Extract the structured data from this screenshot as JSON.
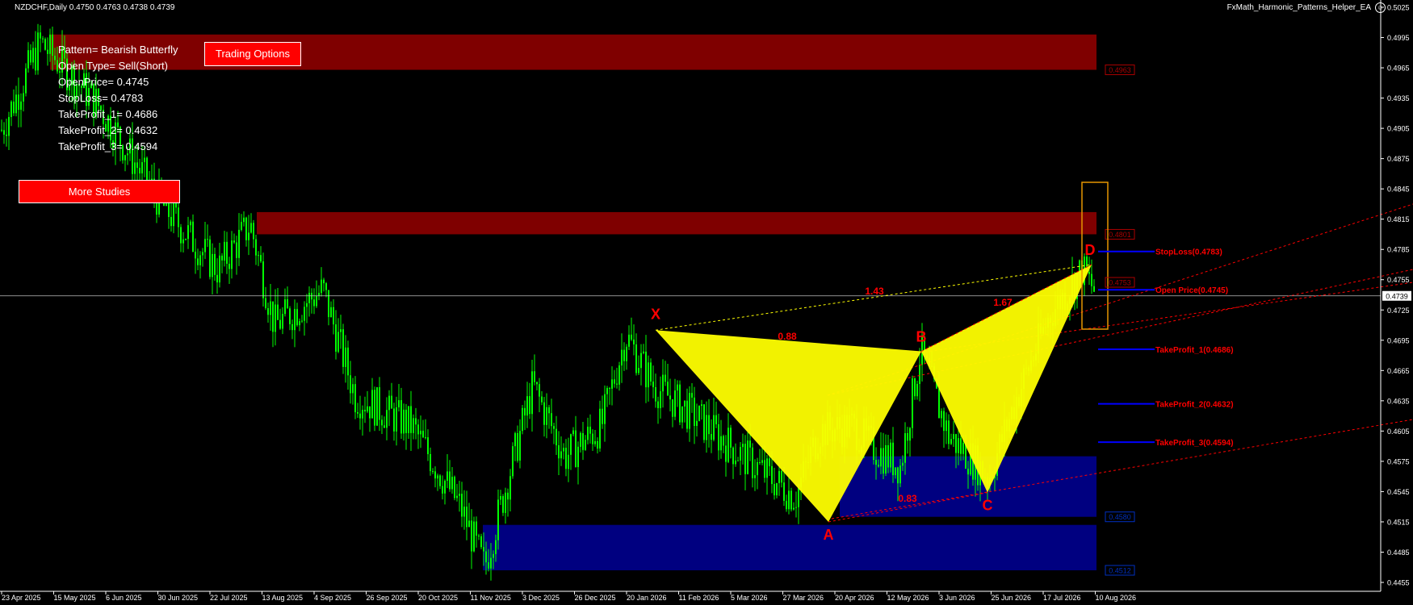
{
  "window": {
    "symbol_line": "NZDCHF,Daily  0.4750 0.4763 0.4738 0.4739",
    "ea_name": "FxMath_Harmonic_Patterns_Helper_EA",
    "ea_icon": "smiley-icon"
  },
  "info": {
    "pattern": "Pattern= Bearish Butterfly",
    "open_type": "Open Type= Sell(Short)",
    "open_price": "OpenPrice= 0.4745",
    "stop_loss": "StopLoss= 0.4783",
    "tp1": "TakeProfit_1= 0.4686",
    "tp2": "TakeProfit_2= 0.4632",
    "tp3": "TakeProfit_3= 0.4594"
  },
  "buttons": {
    "trading_options": "Trading Options",
    "more_studies": "More Studies"
  },
  "price_axis": {
    "labels": [
      "0.5025",
      "0.4995",
      "0.4965",
      "0.4935",
      "0.4905",
      "0.4875",
      "0.4845",
      "0.4815",
      "0.4785",
      "0.4755",
      "0.4725",
      "0.4695",
      "0.4665",
      "0.4635",
      "0.4605",
      "0.4575",
      "0.4545",
      "0.4515",
      "0.4485",
      "0.4455"
    ],
    "current_price": "0.4739"
  },
  "time_axis": {
    "labels": [
      "23 Apr 2025",
      "15 May 2025",
      "6 Jun 2025",
      "30 Jun 2025",
      "22 Jul 2025",
      "13 Aug 2025",
      "4 Sep 2025",
      "26 Sep 2025",
      "20 Oct 2025",
      "11 Nov 2025",
      "3 Dec 2025",
      "26 Dec 2025",
      "20 Jan 2026",
      "11 Feb 2026",
      "5 Mar 2026",
      "27 Mar 2026",
      "20 Apr 2026",
      "12 May 2026",
      "3 Jun 2026",
      "25 Jun 2026",
      "17 Jul 2026",
      "10 Aug 2026"
    ]
  },
  "pattern": {
    "points": [
      {
        "label": "X",
        "price": 0.4705
      },
      {
        "label": "A",
        "price": 0.4515
      },
      {
        "label": "B",
        "price": 0.4684
      },
      {
        "label": "C",
        "price": 0.4544
      },
      {
        "label": "D",
        "price": 0.477
      }
    ],
    "ratios": [
      "0.88",
      "1.43",
      "1.67",
      "0.83"
    ]
  },
  "zones": [
    {
      "top": 0.4998,
      "bottom": 0.4963,
      "color": "#7f0000",
      "label": "0.4963"
    },
    {
      "top": 0.4822,
      "bottom": 0.48,
      "color": "#7f0000",
      "label": "0.4801"
    },
    {
      "top": 0.458,
      "bottom": 0.452,
      "color": "#000080",
      "label": "0.4580"
    },
    {
      "top": 0.4512,
      "bottom": 0.4467,
      "color": "#000080",
      "label": "0.4512"
    }
  ],
  "trade_levels": [
    {
      "label": "StopLoss(0.4783)",
      "price": 0.4783
    },
    {
      "label": "Open Price(0.4745)",
      "price": 0.4745
    },
    {
      "label": "TakeProfit_1(0.4686)",
      "price": 0.4686
    },
    {
      "label": "TakeProfit_2(0.4632)",
      "price": 0.4632
    },
    {
      "label": "TakeProfit_3(0.4594)",
      "price": 0.4594
    }
  ],
  "d_zone_label": "0.4753",
  "colors": {
    "candles": "#00ff00",
    "pattern_fill": "#ffff00",
    "level_line": "#0000ff",
    "level_text": "#ff0000",
    "trend_lines": "#ff0000",
    "d_box": "#e69500",
    "current_price_line": "#c0c0c0"
  }
}
